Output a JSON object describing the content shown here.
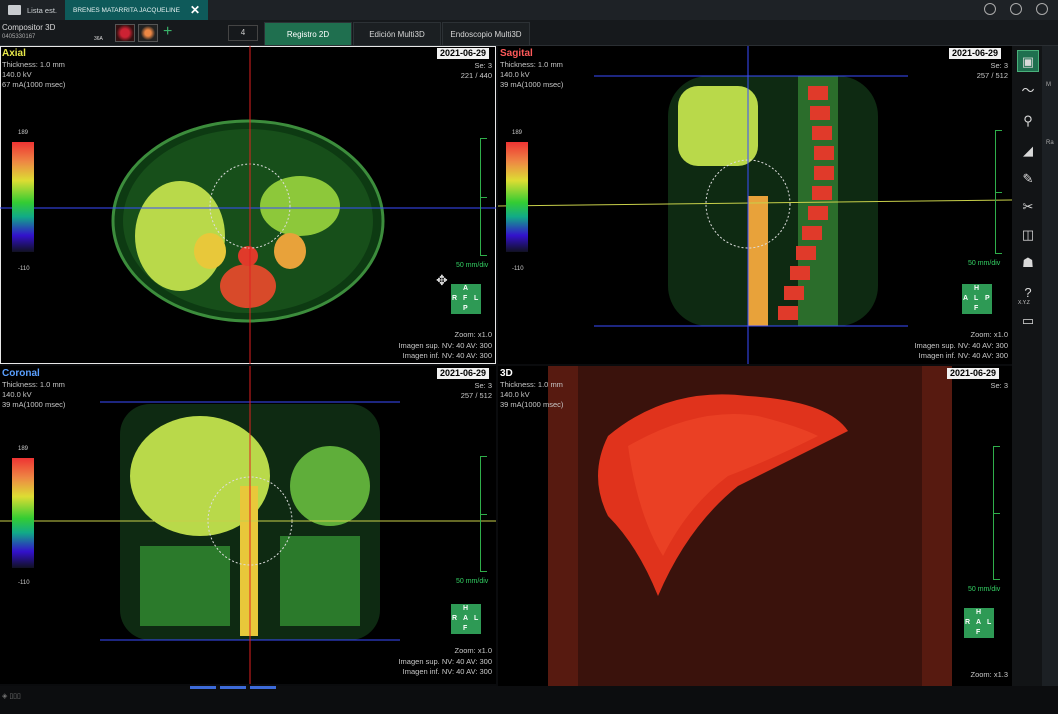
{
  "topbar": {
    "home_tab": "Lista est.",
    "patient_tab": "BRENES MATARRITA JACQUELINE"
  },
  "toolbar": {
    "composer_title": "Compositor 3D",
    "composer_id": "0405330167",
    "series_tag": "36A",
    "layout_label": "4",
    "mode_tabs": [
      "Registro 2D",
      "Edición Multi3D",
      "Endoscopio Multi3D"
    ]
  },
  "viewports": {
    "axial": {
      "title": "Axial",
      "title_color": "#e8e84a",
      "info": [
        "Thickness: 1.0 mm",
        "140.0 kV",
        "67 mA(1000 msec)"
      ],
      "date": "2021-06-29",
      "se": [
        "Se: 3",
        "221 / 440"
      ],
      "cbar_max": "189",
      "cbar_min": "-110",
      "scale": "50  mm/div",
      "orient": {
        "top": "A",
        "left": "R",
        "center": "F",
        "right": "L",
        "bottom": "P"
      },
      "bottom": [
        "Zoom: x1.0",
        "Imagen sup. NV: 40  AV: 300",
        "Imagen inf. NV: 40  AV: 300"
      ]
    },
    "sagittal": {
      "title": "Sagital",
      "title_color": "#ff5a5a",
      "info": [
        "Thickness: 1.0 mm",
        "140.0 kV",
        "39 mA(1000 msec)"
      ],
      "date": "2021-06-29",
      "se": [
        "Se: 3",
        "257 / 512"
      ],
      "cbar_max": "189",
      "cbar_min": "-110",
      "scale": "50  mm/div",
      "orient": {
        "top": "H",
        "left": "A",
        "center": "L",
        "right": "P",
        "bottom": "F"
      },
      "bottom": [
        "Zoom: x1.0",
        "Imagen sup. NV: 40  AV: 300",
        "Imagen inf. NV: 40  AV: 300"
      ]
    },
    "coronal": {
      "title": "Coronal",
      "title_color": "#5aa0ff",
      "info": [
        "Thickness: 1.0 mm",
        "140.0 kV",
        "39 mA(1000 msec)"
      ],
      "date": "2021-06-29",
      "se": [
        "Se: 3",
        "257 / 512"
      ],
      "cbar_max": "189",
      "cbar_min": "-110",
      "scale": "50  mm/div",
      "orient": {
        "top": "H",
        "left": "R",
        "center": "A",
        "right": "L",
        "bottom": "F"
      },
      "bottom": [
        "Zoom: x1.0",
        "Imagen sup. NV: 40  AV: 300",
        "Imagen inf. NV: 40  AV: 300"
      ]
    },
    "volume": {
      "title": "3D",
      "title_color": "#ffffff",
      "info": [
        "Thickness: 1.0 mm",
        "140.0 kV",
        "39 mA(1000 msec)"
      ],
      "date": "2021-06-29",
      "se": [
        "Se: 3"
      ],
      "scale": "50  mm/div",
      "orient": {
        "top": "H",
        "left": "R",
        "center": "A",
        "right": "L",
        "bottom": "F"
      },
      "bottom": [
        "Zoom: x1.3"
      ]
    }
  },
  "side_tools": [
    "viewport-icon",
    "curve-icon",
    "magnify-icon",
    "ruler-icon",
    "annotation-icon",
    "scalpel-icon",
    "cube-icon",
    "orientation-icon",
    "xyz-icon",
    "film-icon"
  ],
  "xyz_label": "X.Y.Z",
  "side_text": [
    "Ra",
    "M"
  ],
  "colors": {
    "accent": "#1f6f4f",
    "tab_patient": "#0e5a5a",
    "crosshair_red": "#e02020",
    "crosshair_blue": "#3a4dff",
    "crosshair_yellow": "#c8d04a",
    "scale_green": "#2fae4a"
  }
}
